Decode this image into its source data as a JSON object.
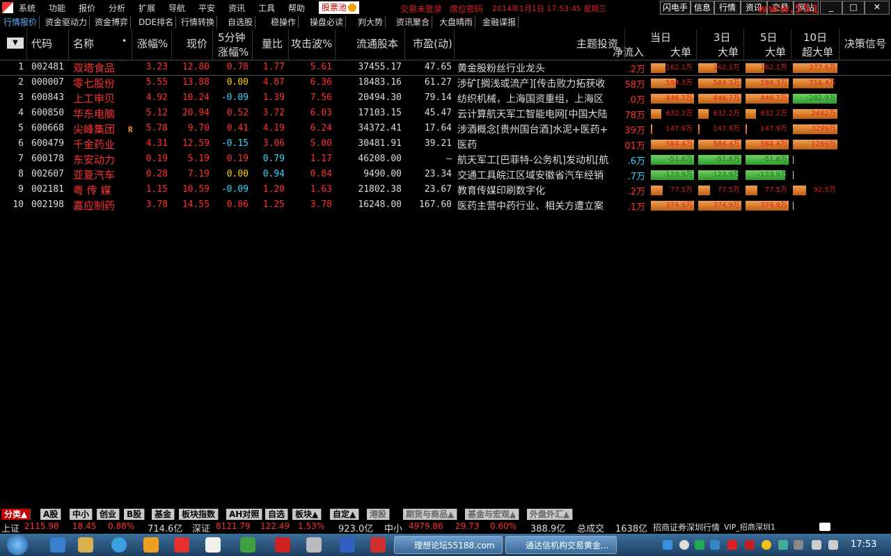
{
  "menu": {
    "items": [
      "系统",
      "功能",
      "报价",
      "分析",
      "扩展",
      "导航",
      "平安",
      "资讯",
      "工具",
      "帮助"
    ],
    "pool_label": "股票池",
    "trade_status": "交易未登录",
    "dw_code": "席位密码",
    "datetime": "2014年1月1日  17:53:45  星期三",
    "right_buttons": [
      "闪电手",
      "信息",
      "行情",
      "资讯",
      "交易",
      "网站"
    ],
    "watermark": "www.55188.com"
  },
  "tabs": [
    "行情报价",
    "资金驱动力",
    "资金博弈",
    "DDE排名",
    "行情转换",
    "自选股",
    "稳操作",
    "操盘必读",
    "判大势",
    "资讯聚合",
    "大盘晴雨",
    "金融谍报"
  ],
  "header": {
    "menu_icon": "▼",
    "code": "代码",
    "name": "名称",
    "name_dot": "•",
    "change_pct": "涨幅%",
    "price": "现价",
    "min5_top": "5分钟",
    "min5_bottom": "涨幅%",
    "vol_ratio": "量比",
    "attack": "攻击波%",
    "float_shares": "流通股本",
    "pe": "市盈(动)",
    "theme": "主题投资",
    "net_inflow": "净流入",
    "day": "当日",
    "d3": "3日",
    "d5": "5日",
    "d10": "10日",
    "big": "大单",
    "super_big": "超大单",
    "signal": "决策信号"
  },
  "rows": [
    {
      "idx": "1",
      "code": "002481",
      "name": "双塔食品",
      "flag": "",
      "chg": "3.23",
      "price": "12.80",
      "m5": "0.78",
      "m5c": "red",
      "vr": "1.77",
      "vrc": "red",
      "atk": "5.61",
      "fs": "37455.17",
      "pe": "47.65",
      "theme": "黄金股粉丝行业龙头",
      "nf": ".2万",
      "nfc": "red",
      "b1": {
        "v": "162.1万",
        "w": 0.34,
        "neg": false
      },
      "b3": {
        "v": "162.1万",
        "w": 0.44,
        "neg": false
      },
      "b5": {
        "v": "162.1万",
        "w": 0.44,
        "neg": false
      },
      "b10": {
        "v": "377.6万",
        "w": 1.0,
        "neg": false
      }
    },
    {
      "idx": "2",
      "code": "000007",
      "name": "零七股份",
      "flag": "",
      "chg": "5.55",
      "price": "13.88",
      "m5": "0.00",
      "m5c": "yellow",
      "vr": "4.87",
      "vrc": "red",
      "atk": "6.36",
      "fs": "18483.16",
      "pe": "61.27",
      "theme": "涉矿[搁浅或流产][传击败力拓获收",
      "nf": "58万",
      "nfc": "red",
      "b1": {
        "v": "584.3万",
        "w": 0.58,
        "neg": false
      },
      "b3": {
        "v": "584.3万",
        "w": 1.0,
        "neg": false
      },
      "b5": {
        "v": "584.3万",
        "w": 1.0,
        "neg": false
      },
      "b10": {
        "v": "716.4万",
        "w": 0.9,
        "neg": false
      }
    },
    {
      "idx": "3",
      "code": "600843",
      "name": "上工申贝",
      "flag": "",
      "chg": "4.92",
      "price": "10.24",
      "m5": "-0.09",
      "m5c": "cyan",
      "vr": "1.39",
      "vrc": "red",
      "atk": "7.56",
      "fs": "20494.30",
      "pe": "79.14",
      "theme": "纺织机械，上海国资重组，上海区",
      "nf": ".0万",
      "nfc": "red",
      "b1": {
        "v": "446.7万",
        "w": 1.0,
        "neg": false
      },
      "b3": {
        "v": "446.7万",
        "w": 1.0,
        "neg": false
      },
      "b5": {
        "v": "446.7万",
        "w": 1.0,
        "neg": false
      },
      "b10": {
        "v": "-282.9万",
        "w": 0.98,
        "neg": true
      }
    },
    {
      "idx": "4",
      "code": "600850",
      "name": "华东电脑",
      "flag": "",
      "chg": "5.12",
      "price": "20.94",
      "m5": "0.52",
      "m5c": "red",
      "vr": "3.72",
      "vrc": "red",
      "atk": "6.03",
      "fs": "17103.15",
      "pe": "45.47",
      "theme": "云计算航天军工智能电网[中国大陆",
      "nf": "78万",
      "nfc": "red",
      "b1": {
        "v": "632.2万",
        "w": 0.24,
        "neg": false
      },
      "b3": {
        "v": "632.2万",
        "w": 0.24,
        "neg": false
      },
      "b5": {
        "v": "632.2万",
        "w": 0.24,
        "neg": false
      },
      "b10": {
        "v": "2482万",
        "w": 1.0,
        "neg": false
      }
    },
    {
      "idx": "5",
      "code": "600668",
      "name": "尖峰集团",
      "flag": "R",
      "chg": "5.78",
      "price": "9.70",
      "m5": "0.41",
      "m5c": "red",
      "vr": "4.19",
      "vrc": "red",
      "atk": "6.24",
      "fs": "34372.41",
      "pe": "17.64",
      "theme": "涉酒概念[贵州国台酒]水泥+医药+",
      "nf": "39万",
      "nfc": "red",
      "b1": {
        "v": "147.9万",
        "w": 0.03,
        "neg": false
      },
      "b3": {
        "v": "147.9万",
        "w": 0.03,
        "neg": false
      },
      "b5": {
        "v": "147.9万",
        "w": 0.03,
        "neg": false
      },
      "b10": {
        "v": "3299万",
        "w": 1.0,
        "neg": false
      }
    },
    {
      "idx": "6",
      "code": "600479",
      "name": "千金药业",
      "flag": "",
      "chg": "4.31",
      "price": "12.59",
      "m5": "-0.15",
      "m5c": "cyan",
      "vr": "3.06",
      "vrc": "red",
      "atk": "5.00",
      "fs": "30481.91",
      "pe": "39.21",
      "theme": "医药",
      "nf": "01万",
      "nfc": "red",
      "b1": {
        "v": "584.4万",
        "w": 1.0,
        "neg": false
      },
      "b3": {
        "v": "584.4万",
        "w": 1.0,
        "neg": false
      },
      "b5": {
        "v": "584.4万",
        "w": 1.0,
        "neg": false
      },
      "b10": {
        "v": "1269万",
        "w": 1.0,
        "neg": false
      }
    },
    {
      "idx": "7",
      "code": "600178",
      "name": "东安动力",
      "flag": "",
      "chg": "0.19",
      "price": "5.19",
      "m5": "0.19",
      "m5c": "red",
      "vr": "0.79",
      "vrc": "cyan",
      "atk": "1.17",
      "fs": "46208.00",
      "pe": "–",
      "theme": "航天军工[巴菲特-公务机]发动机[航",
      "nf": ".6万",
      "nfc": "cyan",
      "b1": {
        "v": "-51.8万",
        "w": 1.0,
        "neg": true
      },
      "b3": {
        "v": "-51.8万",
        "w": 1.0,
        "neg": true
      },
      "b5": {
        "v": "-51.8万",
        "w": 1.0,
        "neg": true
      },
      "b10": {
        "v": "",
        "w": 0.0,
        "neg": false
      }
    },
    {
      "idx": "8",
      "code": "002607",
      "name": "亚夏汽车",
      "flag": "",
      "chg": "0.28",
      "price": "7.19",
      "m5": "0.00",
      "m5c": "yellow",
      "vr": "0.94",
      "vrc": "cyan",
      "atk": "0.84",
      "fs": "9490.00",
      "pe": "23.34",
      "theme": "交通工具皖江区域安徽省汽车经销",
      "nf": ".7万",
      "nfc": "cyan",
      "b1": {
        "v": "-123.9万",
        "w": 1.0,
        "neg": true
      },
      "b3": {
        "v": "-123.9万",
        "w": 0.92,
        "neg": true
      },
      "b5": {
        "v": "-123.9万",
        "w": 0.92,
        "neg": true
      },
      "b10": {
        "v": "",
        "w": 0.0,
        "neg": false
      }
    },
    {
      "idx": "9",
      "code": "002181",
      "name": "粤 传 媒",
      "flag": "",
      "chg": "1.15",
      "price": "10.59",
      "m5": "-0.09",
      "m5c": "cyan",
      "vr": "1.20",
      "vrc": "red",
      "atk": "1.63",
      "fs": "21802.38",
      "pe": "23.67",
      "theme": "教育传媒印刷数字化",
      "nf": ".2万",
      "nfc": "red",
      "b1": {
        "v": "77.5万",
        "w": 0.28,
        "neg": false
      },
      "b3": {
        "v": "77.5万",
        "w": 0.28,
        "neg": false
      },
      "b5": {
        "v": "77.5万",
        "w": 0.28,
        "neg": false
      },
      "b10": {
        "v": "92.5万",
        "w": 0.3,
        "neg": false
      }
    },
    {
      "idx": "10",
      "code": "002198",
      "name": "嘉应制药",
      "flag": "",
      "chg": "3.78",
      "price": "14.55",
      "m5": "0.06",
      "m5c": "red",
      "vr": "1.25",
      "vrc": "red",
      "atk": "3.78",
      "fs": "16248.00",
      "pe": "167.60",
      "theme": "医药主营中药行业、相关方遭立案",
      "nf": ".1万",
      "nfc": "red",
      "b1": {
        "v": "374.9万",
        "w": 1.0,
        "neg": false
      },
      "b3": {
        "v": "374.9万",
        "w": 1.0,
        "neg": false
      },
      "b5": {
        "v": "374.9万",
        "w": 1.0,
        "neg": false
      },
      "b10": {
        "v": "",
        "w": 0.0,
        "neg": false
      }
    }
  ],
  "category_tabs": [
    "分类▲",
    "A股",
    "中小",
    "创业",
    "B股",
    "基金",
    "板块指数",
    "AH对照",
    "自选",
    "板块▲",
    "自定▲",
    "港股",
    "期货与商品▲",
    "基金与宏观▲",
    "外盘外汇▲"
  ],
  "status": {
    "sh_label": "上证",
    "sh_index": "2115.98",
    "sh_chg": "18.45",
    "sh_pct": "0.88%",
    "sh_amt": "714.6亿",
    "sz_label": "深证",
    "sz_index": "8121.79",
    "sz_chg": "122.49",
    "sz_pct": "1.53%",
    "sz_amt": "923.0亿",
    "zx_label": "中小",
    "zx_index": "4979.86",
    "zx_chg": "29.73",
    "zx_pct": "0.60%",
    "zx_amt": "388.9亿",
    "total_label": "总成交",
    "total_amt": "1638亿",
    "broker": "招商证券深圳行情",
    "vip": "VIP_招商深圳1"
  },
  "taskbar": {
    "btn1": "理想论坛55188.com",
    "btn2": "通达信机构交易黄金...",
    "clock": "17:53"
  }
}
